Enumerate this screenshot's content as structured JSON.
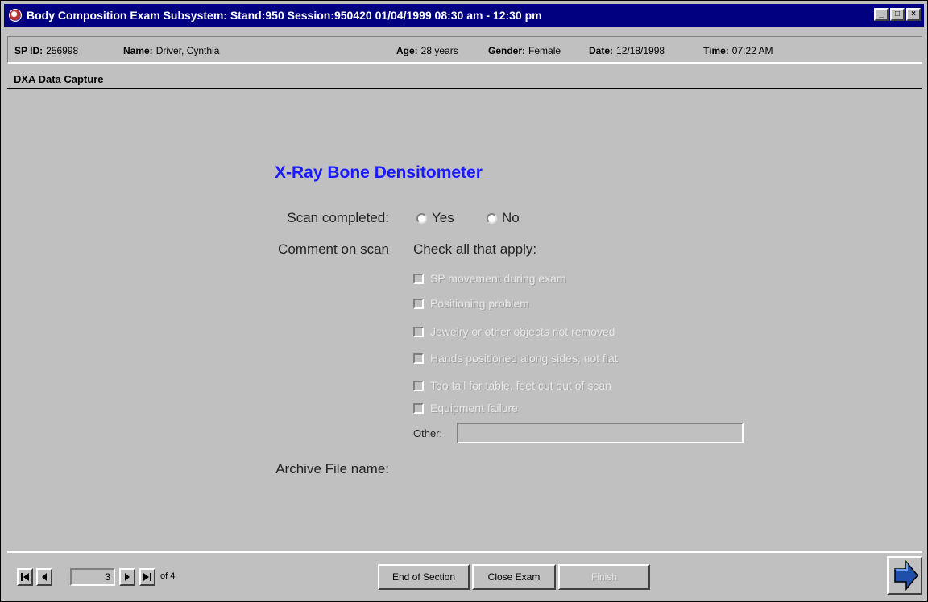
{
  "window": {
    "title": "Body Composition Exam Subsystem: Stand:950 Session:950420 01/04/1999 08:30 am - 12:30 pm",
    "controls": [
      "_",
      "□",
      "×"
    ]
  },
  "patient": {
    "sp_id_label": "SP ID:",
    "sp_id": "256998",
    "name_label": "Name:",
    "name": "Driver, Cynthia",
    "age_label": "Age:",
    "age": "28 years",
    "gender_label": "Gender:",
    "gender": "Female",
    "date_label": "Date:",
    "date": "12/18/1998",
    "time_label": "Time:",
    "time": "07:22 AM"
  },
  "section": {
    "title": "DXA Data Capture"
  },
  "form": {
    "heading": "X-Ray Bone Densitometer",
    "scan_completed_label": "Scan completed:",
    "yes_label": "Yes",
    "no_label": "No",
    "comment_label": "Comment on scan",
    "check_all_label": "Check all that apply:",
    "checks": [
      "SP movement during exam",
      "Positioning problem",
      "Jewelry or other objects not removed",
      "Hands positioned along sides, not flat",
      "Too tall for table, feet cut out of scan",
      "Equipment failure"
    ],
    "other_label": "Other:",
    "other_value": "",
    "archive_label": "Archive File name:"
  },
  "nav": {
    "page": "3",
    "of_text": "of 4",
    "end_section": "End of Section",
    "close_exam": "Close Exam",
    "finish": "Finish"
  },
  "colors": {
    "titlebar": "#000080",
    "heading": "#1a1aff",
    "arrow": "#1f4fa8"
  },
  "icons": [
    "app-icon",
    "first-page-icon",
    "prev-page-icon",
    "next-page-icon",
    "last-page-icon",
    "next-arrow-icon"
  ]
}
